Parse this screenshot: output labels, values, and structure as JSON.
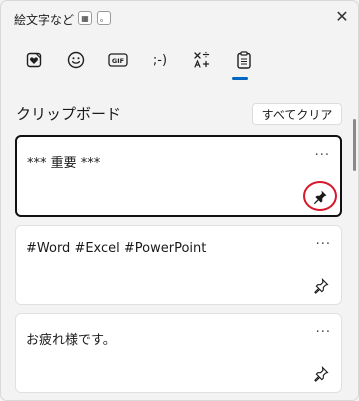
{
  "window": {
    "title": "絵文字など",
    "kbd_icon_glyph": "▦",
    "kbd_dot_glyph": "。",
    "close_glyph": "✕"
  },
  "tabs": [
    {
      "name": "kaomoji-heart",
      "icon": "heart-sticker-icon"
    },
    {
      "name": "emoji",
      "icon": "smiley-icon"
    },
    {
      "name": "gif",
      "icon": "gif-icon",
      "label": "GIF"
    },
    {
      "name": "text-emoticon",
      "icon": "emoticon-icon",
      "label": ";-)"
    },
    {
      "name": "symbols",
      "icon": "symbols-icon"
    },
    {
      "name": "clipboard",
      "icon": "clipboard-icon",
      "active": true
    }
  ],
  "clipboard": {
    "section_title": "クリップボード",
    "clear_all_label": "すべてクリア",
    "items": [
      {
        "text": "*** 重要 ***",
        "more_glyph": "···",
        "pinned": true,
        "selected": true
      },
      {
        "text": "#Word #Excel #PowerPoint",
        "more_glyph": "···",
        "pinned": false,
        "selected": false
      },
      {
        "text": "お疲れ様です。",
        "more_glyph": "···",
        "pinned": false,
        "selected": false
      }
    ]
  },
  "colors": {
    "accent": "#0067c0",
    "highlight": "#d7182a"
  }
}
